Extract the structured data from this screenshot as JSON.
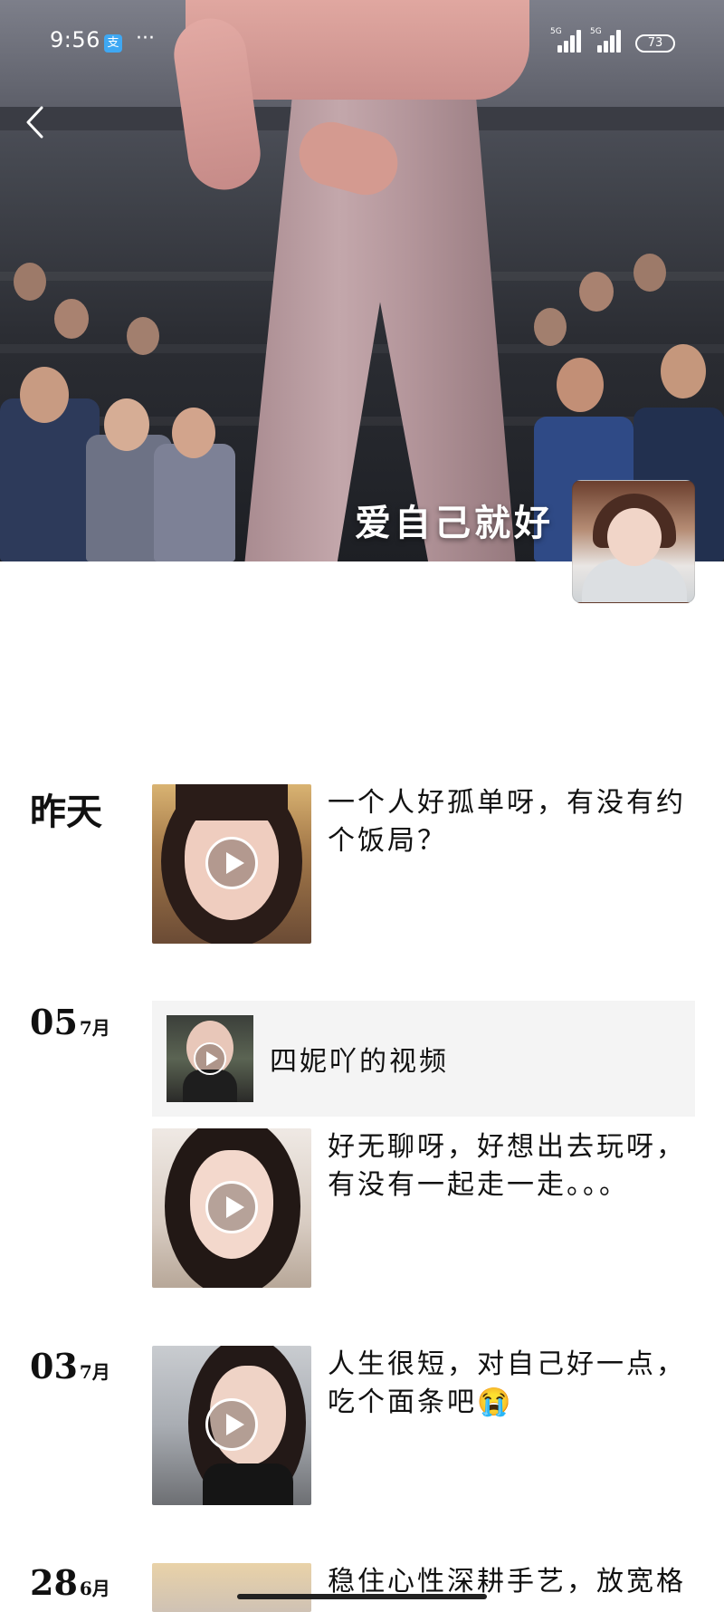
{
  "status_bar": {
    "time": "9:56",
    "alipay_glyph": "支",
    "more": "···",
    "network_1": "5G",
    "network_2": "5G",
    "battery": "73"
  },
  "header": {
    "back_icon": "chevron-left-icon",
    "cover_caption": "爱自己就好"
  },
  "feed": {
    "posts": [
      {
        "day_label": "昨天",
        "text": "一个人好孤单呀，有没有约个饭局？",
        "media": "video"
      },
      {
        "day": "05",
        "month": "7月",
        "share": {
          "title": "四妮吖的视频"
        },
        "text": "好无聊呀，好想出去玩呀，有没有一起走一走。。。",
        "media": "video"
      },
      {
        "day": "03",
        "month": "7月",
        "text": "人生很短，对自己好一点，吃个面条吧😭",
        "media": "video"
      },
      {
        "day": "28",
        "month": "6月",
        "text": "稳住心性深耕手艺，放宽格",
        "media": "video"
      }
    ]
  },
  "colors": {
    "background": "#ffffff",
    "text": "#111111",
    "share_card_bg": "#f4f4f4"
  }
}
